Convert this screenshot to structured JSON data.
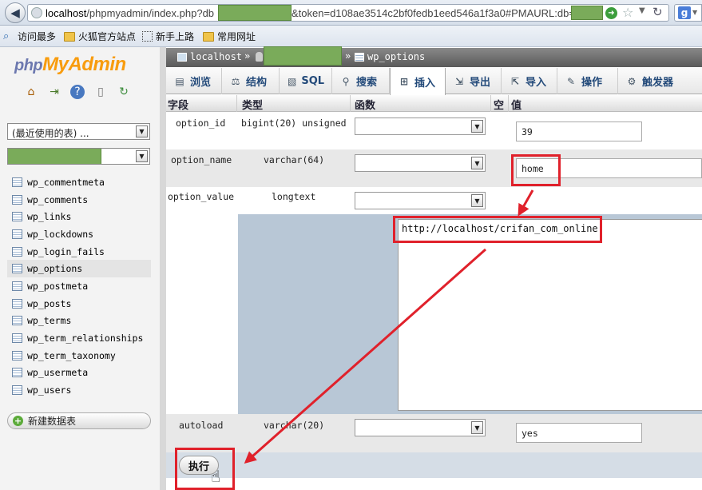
{
  "browser": {
    "url_prefix": "localhost",
    "url_path": "/phpmyadmin/index.php?db",
    "url_middle": "&token=d108ae3514c2bf0fedb1eed546a1f3a0#PMAURL:db=",
    "back_icon": "back-arrow-icon",
    "reload_icon": "reload-icon",
    "star_icon": "bookmark-star-icon",
    "search_engine_icon": "google-icon"
  },
  "bookmarks": [
    {
      "label": "访问最多",
      "icon": "magnifier-icon"
    },
    {
      "label": "火狐官方站点",
      "icon": "folder-icon"
    },
    {
      "label": "新手上路",
      "icon": "dotted-icon"
    },
    {
      "label": "常用网址",
      "icon": "folder-icon"
    }
  ],
  "logo": {
    "php": "php",
    "my": "My",
    "admin": "Admin"
  },
  "sidebar": {
    "recent_tables": "(最近使用的表) ...",
    "tables": [
      "wp_commentmeta",
      "wp_comments",
      "wp_links",
      "wp_lockdowns",
      "wp_login_fails",
      "wp_options",
      "wp_postmeta",
      "wp_posts",
      "wp_terms",
      "wp_term_relationships",
      "wp_term_taxonomy",
      "wp_usermeta",
      "wp_users"
    ],
    "active_table": "wp_options",
    "new_table_label": "新建数据表"
  },
  "breadcrumb": {
    "server": "localhost",
    "sep": "»",
    "table": "wp_options"
  },
  "tabs": [
    {
      "label": "浏览",
      "icon": "browse-icon"
    },
    {
      "label": "结构",
      "icon": "structure-icon"
    },
    {
      "label": "SQL",
      "icon": "sql-icon"
    },
    {
      "label": "搜索",
      "icon": "search-icon"
    },
    {
      "label": "插入",
      "icon": "insert-icon",
      "active": true
    },
    {
      "label": "导出",
      "icon": "export-icon"
    },
    {
      "label": "导入",
      "icon": "import-icon"
    },
    {
      "label": "操作",
      "icon": "operations-icon"
    },
    {
      "label": "触发器",
      "icon": "triggers-icon"
    }
  ],
  "columns": {
    "field": "字段",
    "type": "类型",
    "function": "函数",
    "null": "空",
    "value": "值"
  },
  "rows": [
    {
      "field": "option_id",
      "type": "bigint(20) unsigned",
      "value": "39"
    },
    {
      "field": "option_name",
      "type": "varchar(64)",
      "value": "home"
    },
    {
      "field": "option_value",
      "type": "longtext",
      "value": "http://localhost/crifan_com_online"
    },
    {
      "field": "autoload",
      "type": "varchar(20)",
      "value": "yes"
    }
  ],
  "execute_label": "执行",
  "annotation_color": "#e0212b"
}
